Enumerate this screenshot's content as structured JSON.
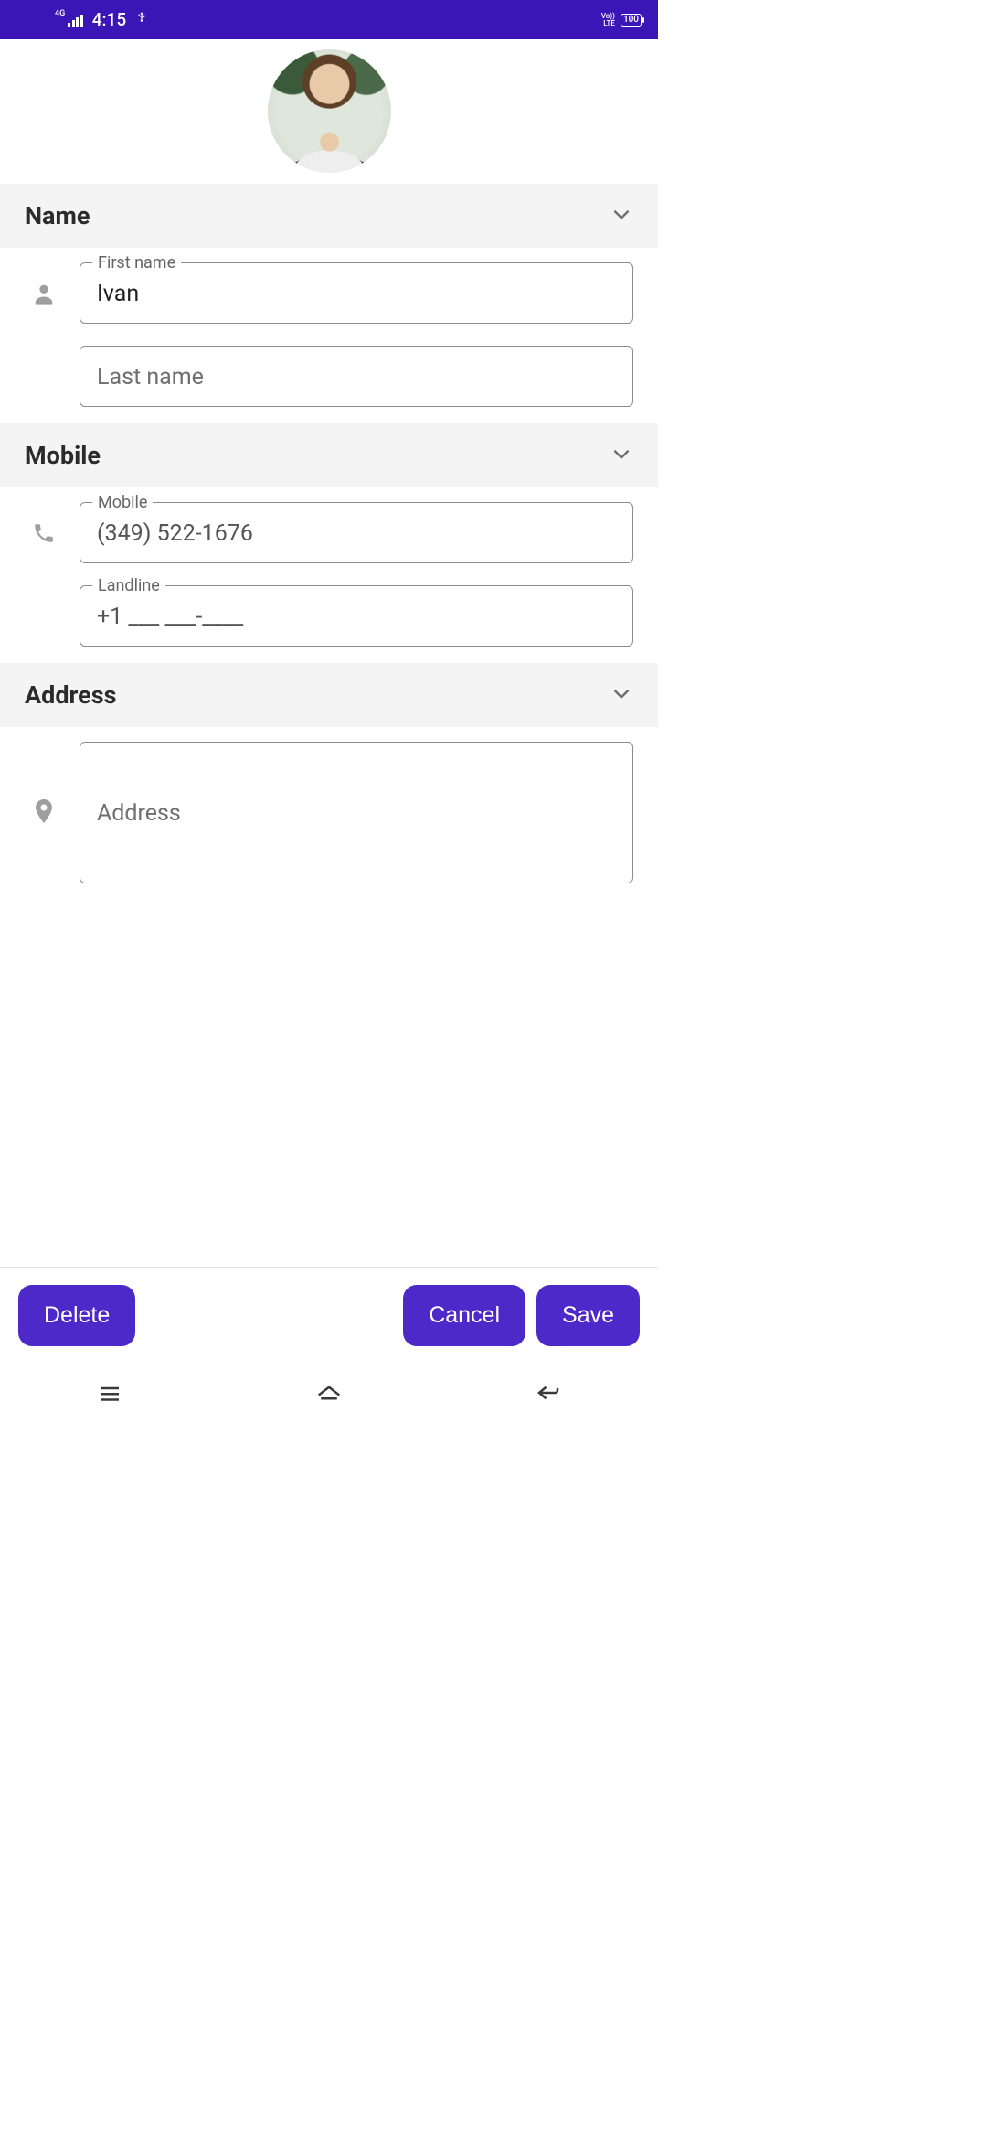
{
  "status": {
    "network_label": "4G",
    "time": "4:15",
    "volte": "Vo))\nLTE",
    "battery": "100"
  },
  "sections": {
    "name": {
      "title": "Name",
      "first_name_label": "First name",
      "first_name_value": "Ivan",
      "last_name_placeholder": "Last name",
      "last_name_value": ""
    },
    "mobile": {
      "title": "Mobile",
      "mobile_label": "Mobile",
      "mobile_value": "(349) 522-1676",
      "landline_label": "Landline",
      "landline_value": "+1 ___ ___-____"
    },
    "address": {
      "title": "Address",
      "address_placeholder": "Address",
      "address_value": ""
    }
  },
  "actions": {
    "delete": "Delete",
    "cancel": "Cancel",
    "save": "Save"
  }
}
